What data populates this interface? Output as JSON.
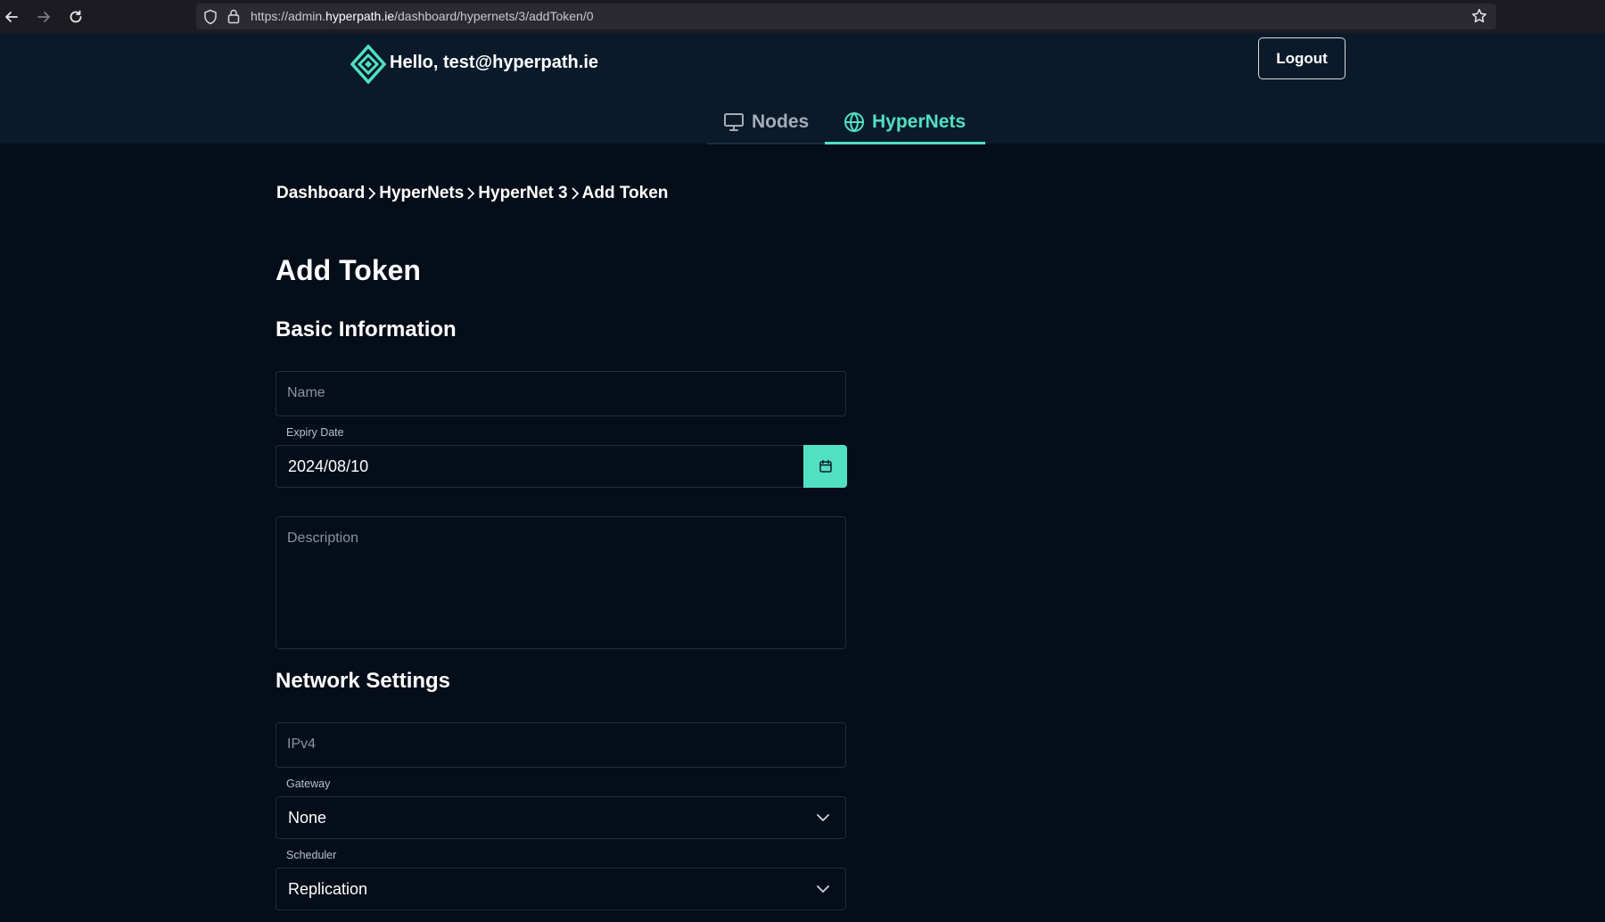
{
  "browser": {
    "url_prefix": "https://admin.",
    "url_domain": "hyperpath.ie",
    "url_path": "/dashboard/hypernets/3/addToken/0"
  },
  "header": {
    "greeting": "Hello, test@hyperpath.ie",
    "logout_label": "Logout"
  },
  "tabs": [
    {
      "label": "Nodes",
      "icon": "monitor-icon",
      "active": false
    },
    {
      "label": "HyperNets",
      "icon": "globe-icon",
      "active": true
    }
  ],
  "breadcrumb": [
    "Dashboard",
    "HyperNets",
    "HyperNet 3",
    "Add Token"
  ],
  "page_title": "Add Token",
  "sections": {
    "basic": {
      "title": "Basic Information",
      "name_placeholder": "Name",
      "expiry_label": "Expiry Date",
      "expiry_value": "2024/08/10",
      "description_placeholder": "Description"
    },
    "network": {
      "title": "Network Settings",
      "ipv4_placeholder": "IPv4",
      "gateway_label": "Gateway",
      "gateway_value": "None",
      "scheduler_label": "Scheduler",
      "scheduler_value": "Replication"
    }
  },
  "colors": {
    "accent": "#52e0c4",
    "background": "#050d18",
    "header": "#0b1a2a"
  }
}
